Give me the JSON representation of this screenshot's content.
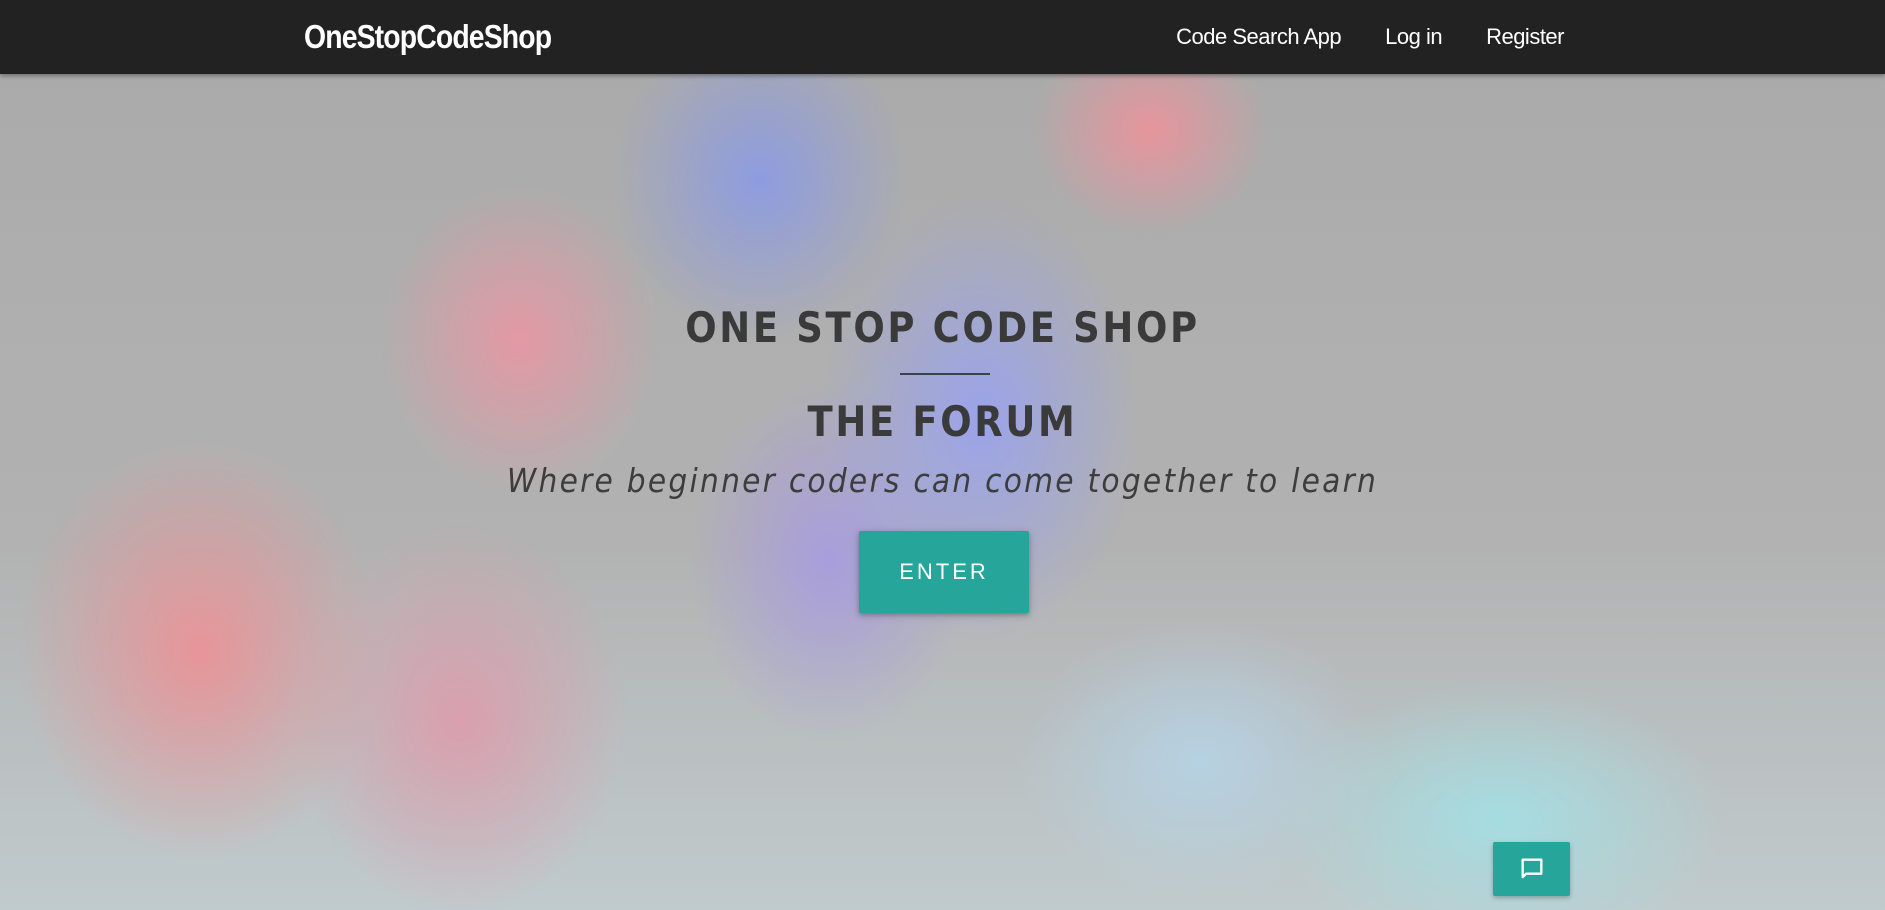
{
  "navbar": {
    "brand": "OneStopCodeShop",
    "links": [
      {
        "label": "Code Search App"
      },
      {
        "label": "Log in"
      },
      {
        "label": "Register"
      }
    ]
  },
  "hero": {
    "title": "ONE STOP CODE SHOP",
    "subtitle": "THE FORUM",
    "tagline": "Where beginner coders can come together to learn",
    "enter_label": "ENTER",
    "background": "colored smoke photograph (pink, blue, teal on grey)"
  },
  "chat_widget": {
    "icon": "chat-bubble-icon"
  },
  "colors": {
    "navbar": "#222222",
    "accent": "#26a69a",
    "hero_text": "#3a3a3a"
  }
}
